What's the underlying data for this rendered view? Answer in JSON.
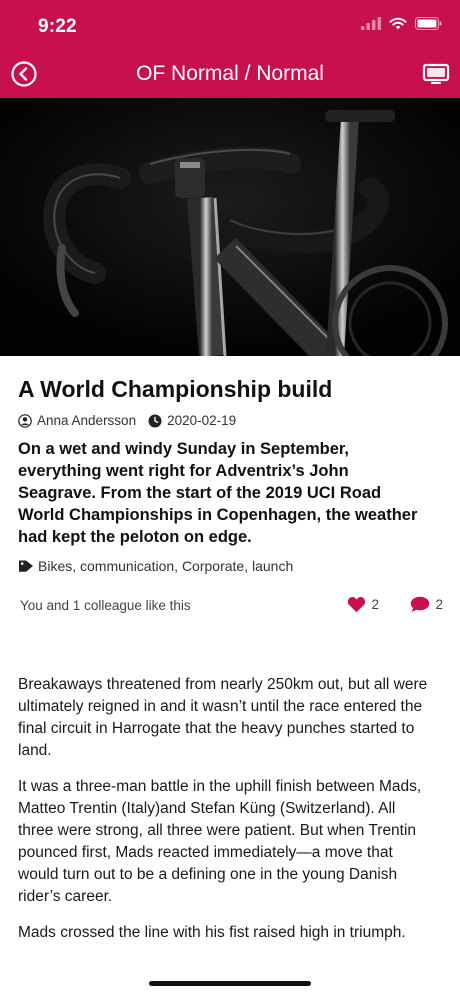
{
  "status": {
    "time": "9:22"
  },
  "nav": {
    "title": "OF Normal / Normal"
  },
  "colors": {
    "accent": "#c8104f"
  },
  "icons": {
    "back": "back-circle-icon",
    "display": "display-icon",
    "author": "person-icon",
    "date": "clock-icon",
    "tags": "tag-icon",
    "like": "heart-icon",
    "comment": "comment-icon"
  },
  "article": {
    "title": "A World Championship build",
    "author": "Anna Andersson",
    "date": "2020-02-19",
    "lead": "On a wet and windy Sunday in September, everything went right for Adventrix’s John Seagrave. From the start of the 2019 UCI Road World Championships in Copenhagen, the weather had kept the peloton on edge.",
    "tags": "Bikes, communication, Corporate, launch",
    "likes_text": "You and 1 colleague like this",
    "like_count": "2",
    "comment_count": "2",
    "paragraphs": [
      "Breakaways threatened from nearly 250km out, but all were ultimately reigned in and it wasn’t until the race entered the final circuit in Harrogate that the heavy punches started to land.",
      "It was a three-man battle in the uphill finish between Mads, Matteo Trentin (Italy)and Stefan Küng (Switzerland). All three were strong, all three were patient. But when Trentin pounced first, Mads reacted immediately—a move that would turn out to be a defining one in the young Danish rider’s career.",
      "Mads crossed the line with his fist raised high in triumph."
    ]
  }
}
